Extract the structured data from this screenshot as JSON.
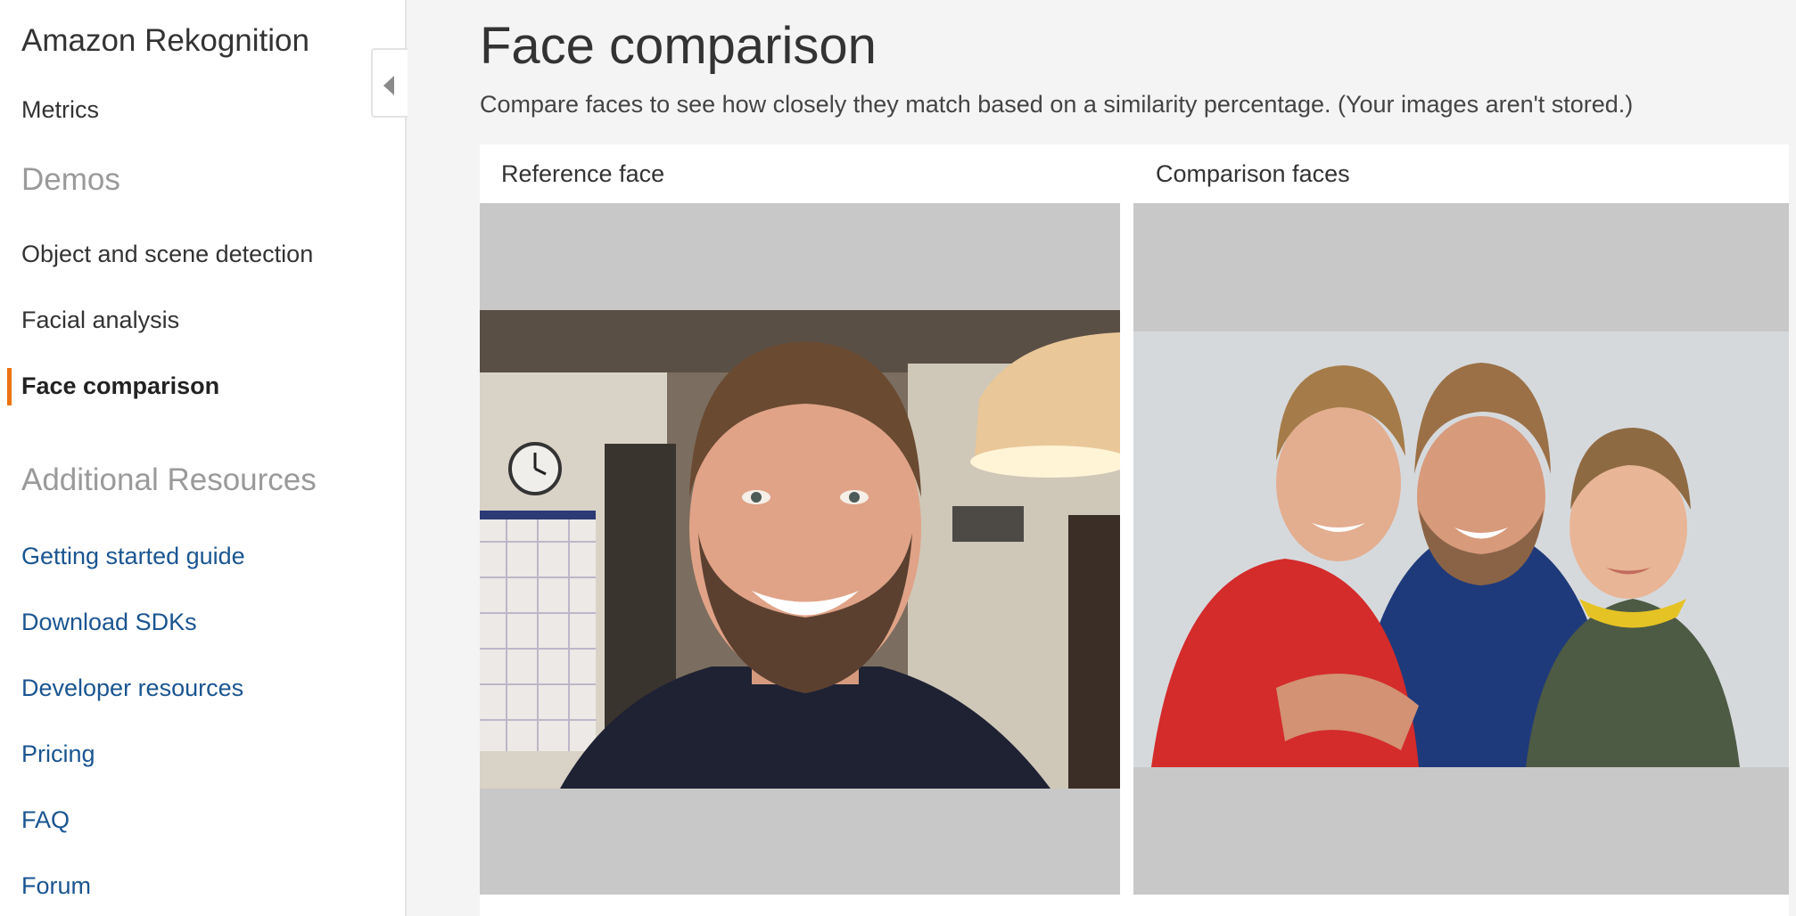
{
  "sidebar": {
    "title": "Amazon Rekognition",
    "metrics": "Metrics",
    "demos_heading": "Demos",
    "demos": [
      {
        "label": "Object and scene detection",
        "active": false
      },
      {
        "label": "Facial analysis",
        "active": false
      },
      {
        "label": "Face comparison",
        "active": true
      }
    ],
    "resources_heading": "Additional Resources",
    "resources": [
      "Getting started guide",
      "Download SDKs",
      "Developer resources",
      "Pricing",
      "FAQ",
      "Forum"
    ]
  },
  "main": {
    "title": "Face comparison",
    "description": "Compare faces to see how closely they match based on a similarity percentage. (Your images aren't stored.)",
    "reference_heading": "Reference face",
    "comparison_heading": "Comparison faces"
  },
  "icons": {
    "collapse": "caret-left-icon"
  },
  "colors": {
    "accent": "#ec7211",
    "link": "#1a5591",
    "muted_heading": "#9a9a9a",
    "image_placeholder": "#c8c8c8"
  }
}
